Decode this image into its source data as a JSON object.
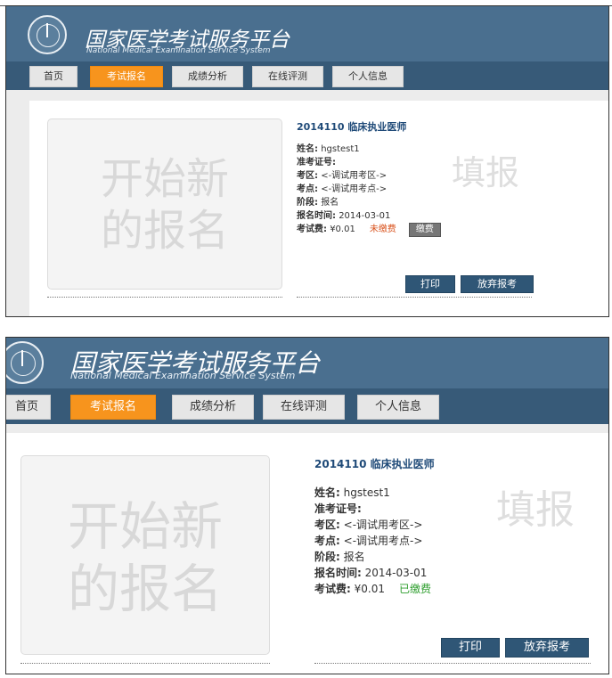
{
  "header": {
    "title_cn": "国家医学考试服务平台",
    "title_en": "National Medical Examination Service System",
    "logo_icon": "medical-emblem-icon"
  },
  "nav": {
    "items": [
      "首页",
      "考试报名",
      "成绩分析",
      "在线评测",
      "个人信息"
    ],
    "active": "考试报名"
  },
  "new_registration": {
    "line1": "开始新",
    "line2": "的报名"
  },
  "watermark": "填报",
  "registration": {
    "exam": "2014110 临床执业医师",
    "name_label": "姓名:",
    "name_value": "hgstest1",
    "ticket_label": "准考证号:",
    "ticket_value": "",
    "district_label": "考区:",
    "district_value": "<-调试用考区->",
    "site_label": "考点:",
    "site_value": "<-调试用考点->",
    "stage_label": "阶段:",
    "stage_value": "报名",
    "time_label": "报名时间:",
    "time_value": "2014-03-01",
    "fee_label": "考试费:",
    "fee_value": "¥0.01"
  },
  "shot1": {
    "fee_status": "未缴费",
    "pay_button": "缴费"
  },
  "shot2": {
    "fee_status": "已缴费"
  },
  "actions": {
    "print": "打印",
    "abandon": "放弃报考"
  },
  "colors": {
    "header": "#4a6f8f",
    "nav": "#375a78",
    "nav_active": "#f7941d",
    "button": "#2f5676",
    "unpaid": "#d9531e",
    "paid": "#2e9e2e"
  }
}
